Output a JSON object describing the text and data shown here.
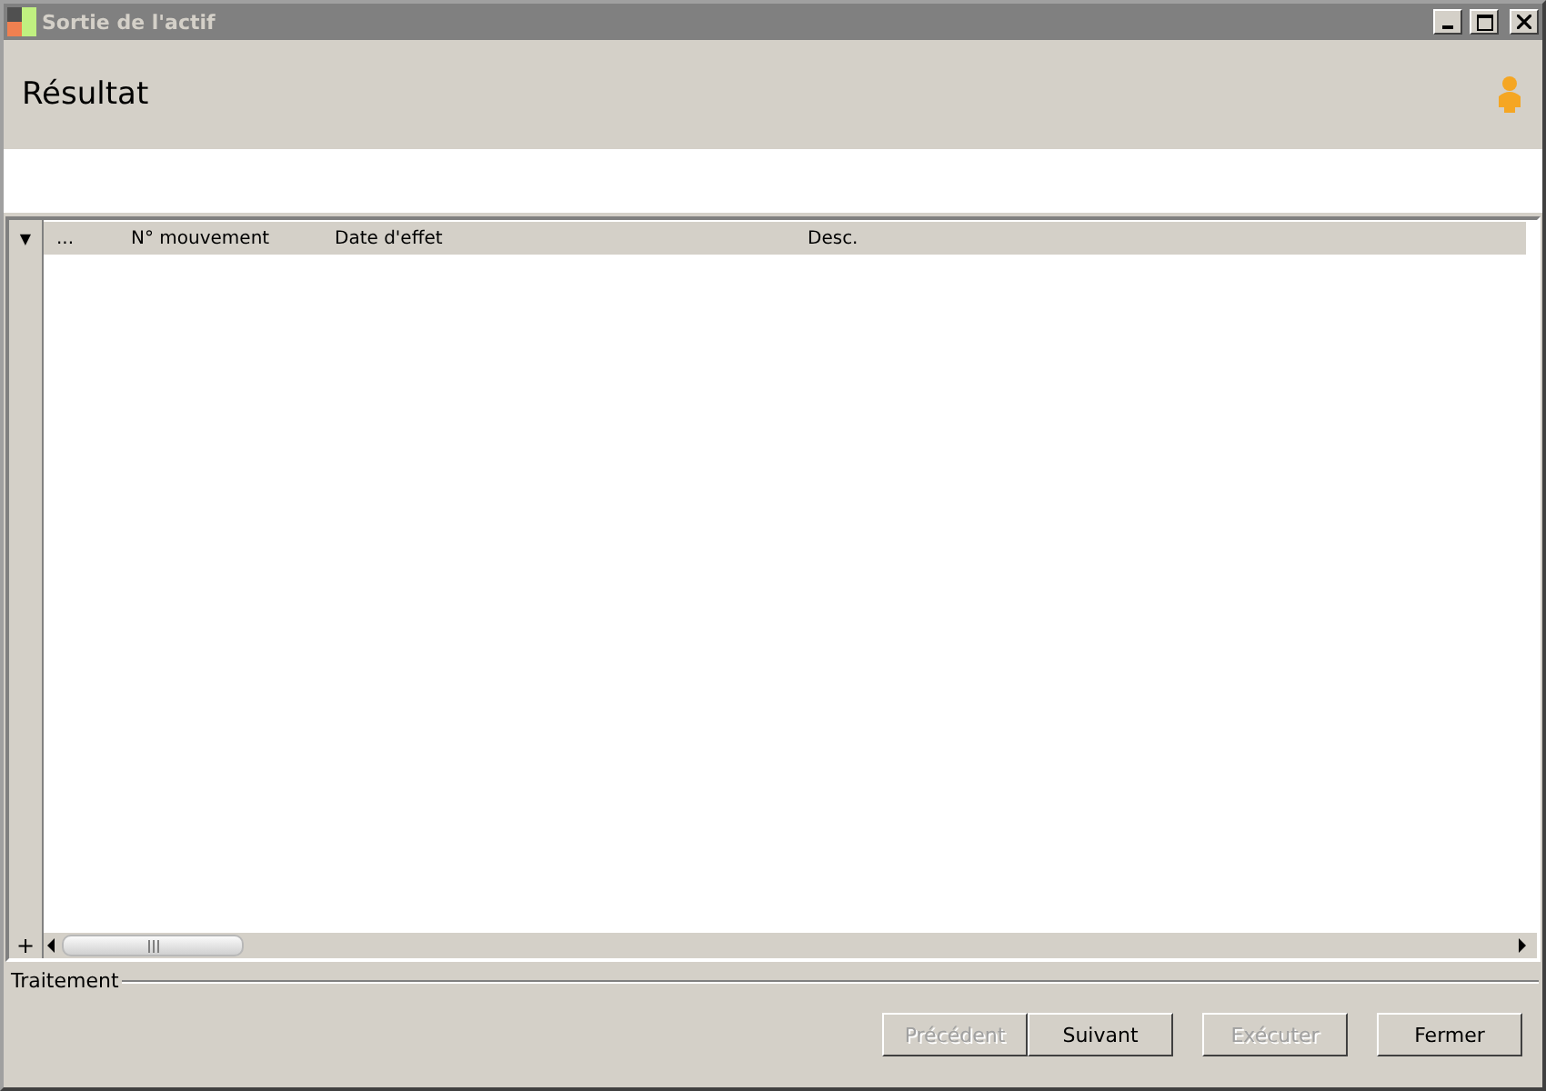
{
  "window": {
    "title": "Sortie de l'actif"
  },
  "header": {
    "title": "Résultat"
  },
  "grid": {
    "menu_glyph": "▼",
    "columns": [
      {
        "label": "..."
      },
      {
        "label": "N° mouvement"
      },
      {
        "label": "Date d'effet"
      },
      {
        "label": "Desc."
      }
    ],
    "add_glyph": "+"
  },
  "group": {
    "label": "Traitement"
  },
  "buttons": [
    {
      "label": "Précédent",
      "disabled": true
    },
    {
      "label": "Suivant",
      "disabled": false
    },
    {
      "label": "Exécuter",
      "disabled": true
    },
    {
      "label": "Fermer",
      "disabled": false
    }
  ]
}
